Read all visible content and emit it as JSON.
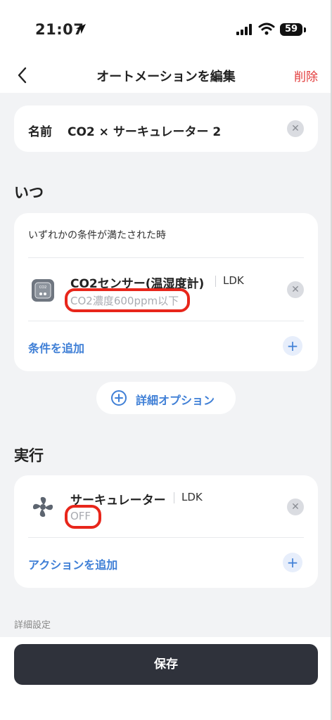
{
  "status_bar": {
    "time": "21:07",
    "battery": "59"
  },
  "nav": {
    "title": "オートメーションを編集",
    "delete_label": "削除"
  },
  "name": {
    "label": "名前",
    "value": "CO2 × サーキュレーター 2"
  },
  "when": {
    "title": "いつ",
    "condition_desc": "いずれかの条件が満たされた時",
    "device": {
      "name": "CO2センサー(温湿度計)",
      "room": "LDK",
      "state": "CO2濃度600ppm以下"
    },
    "add_label": "条件を追加"
  },
  "options_button": {
    "label": "詳細オプション"
  },
  "execute": {
    "title": "実行",
    "device": {
      "name": "サーキュレーター",
      "room": "LDK",
      "state": "OFF"
    },
    "add_label": "アクションを追加"
  },
  "detail_settings": "詳細設定",
  "save_label": "保存",
  "colors": {
    "accent": "#3f7fd6",
    "delete": "#e23b3b",
    "highlight": "#e8261b",
    "save_bg": "#2f323b"
  },
  "icons": [
    "location-arrow-icon",
    "cellular-signal-icon",
    "wifi-icon",
    "chevron-left-icon",
    "clear-icon",
    "co2-sensor-icon",
    "fan-icon",
    "plus-icon",
    "plus-circle-icon"
  ]
}
